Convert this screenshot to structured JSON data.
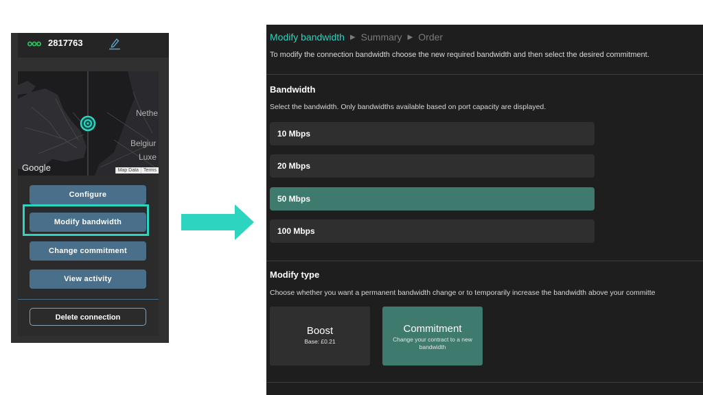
{
  "connection": {
    "id": "2817763",
    "logo": "infinity-logo",
    "edit_icon": "pencil-icon"
  },
  "map": {
    "labels": [
      "Nethe",
      "Belgiur",
      "Luxe"
    ],
    "google": "Google",
    "map_data": "Map Data",
    "terms": "Terms",
    "marker": "location-target-icon"
  },
  "actions": {
    "configure": "Configure",
    "modify_bandwidth": "Modify bandwidth",
    "change_commitment": "Change commitment",
    "view_activity": "View activity",
    "delete_connection": "Delete connection"
  },
  "colors": {
    "accent": "#2dd4bf",
    "button_blue": "#4a6f8a",
    "selected_green": "#3e7a6e",
    "panel_dark": "#1e1e1e"
  },
  "breadcrumb": [
    "Modify bandwidth",
    "Summary",
    "Order"
  ],
  "intro": "To modify the connection bandwidth choose the new required bandwidth and then select the desired commitment.",
  "bandwidth": {
    "title": "Bandwidth",
    "description": "Select the bandwidth. Only bandwidths available based on port capacity are displayed.",
    "options": [
      "10 Mbps",
      "20 Mbps",
      "50 Mbps",
      "100 Mbps"
    ],
    "selected": "50 Mbps"
  },
  "modify_type": {
    "title": "Modify type",
    "description": "Choose whether you want a permanent bandwidth change or to temporarily increase the bandwidth above your committe",
    "boost": {
      "title": "Boost",
      "subtitle": "Base: £0.21"
    },
    "commitment": {
      "title": "Commitment",
      "subtitle": "Change your contract to a new bandwidth",
      "selected": true
    }
  }
}
